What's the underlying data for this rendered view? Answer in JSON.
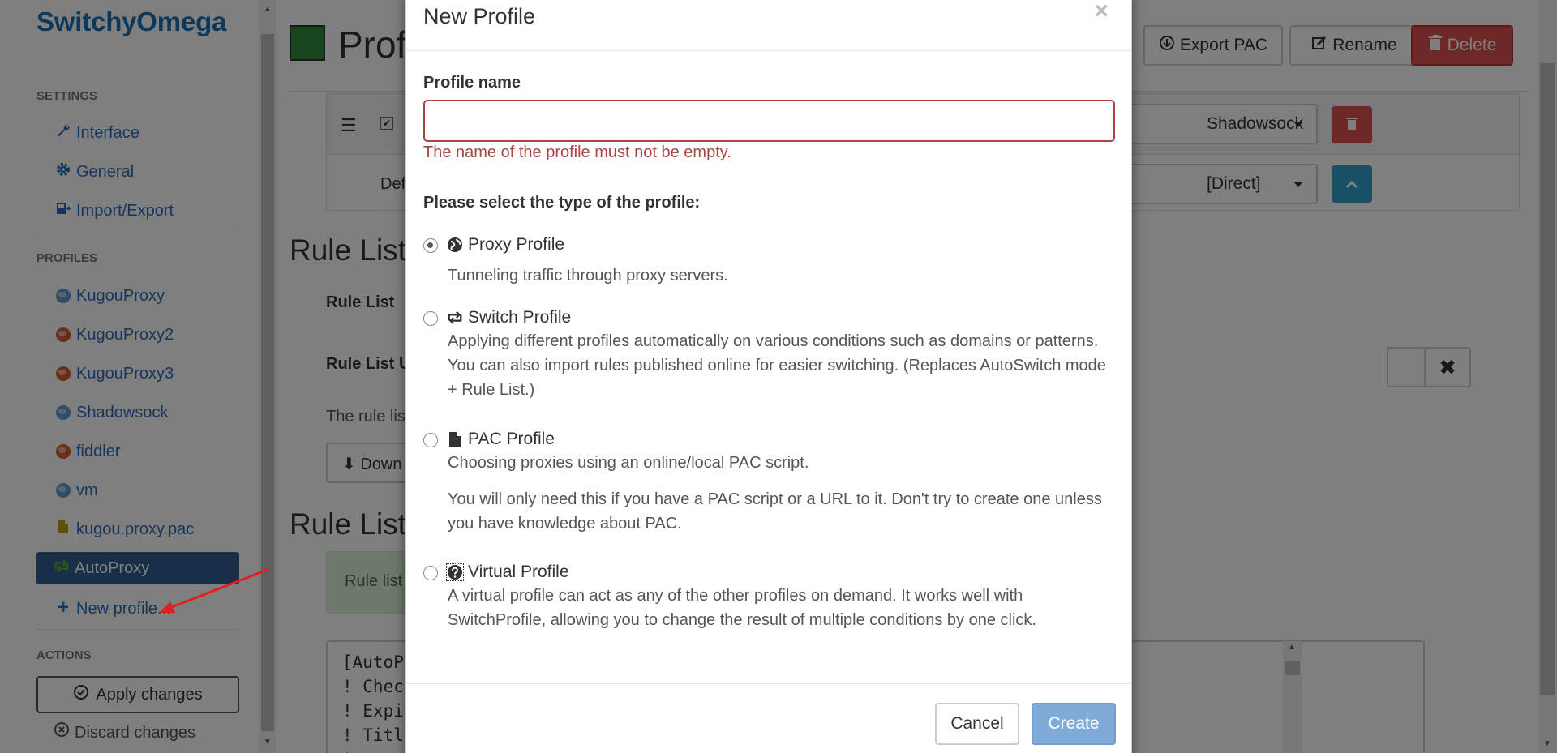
{
  "app": {
    "brand": "SwitchyOmega"
  },
  "sidebar": {
    "settings_header": "SETTINGS",
    "settings_items": [
      {
        "label": "Interface",
        "icon": "wrench-icon"
      },
      {
        "label": "General",
        "icon": "gear-icon"
      },
      {
        "label": "Import/Export",
        "icon": "import-export-icon"
      }
    ],
    "profiles_header": "PROFILES",
    "profiles": [
      {
        "label": "KugouProxy",
        "icon": "globe-icon",
        "color": "#5d9bd5"
      },
      {
        "label": "KugouProxy2",
        "icon": "globe-icon",
        "color": "#d9582b"
      },
      {
        "label": "KugouProxy3",
        "icon": "globe-icon",
        "color": "#d9582b"
      },
      {
        "label": "Shadowsock",
        "icon": "globe-icon",
        "color": "#5d9bd5"
      },
      {
        "label": "fiddler",
        "icon": "globe-icon",
        "color": "#d9582b"
      },
      {
        "label": "vm",
        "icon": "globe-icon",
        "color": "#5d9bd5"
      },
      {
        "label": "kugou.proxy.pac",
        "icon": "file-icon",
        "color": "#b8a015"
      },
      {
        "label": "AutoProxy",
        "icon": "switch-icon",
        "color": "#55b030",
        "active": true
      }
    ],
    "new_profile": "New profile...",
    "actions_header": "ACTIONS",
    "apply_changes": "Apply changes",
    "discard_changes": "Discard changes"
  },
  "main": {
    "page_title": "Profi",
    "export_pac": "Export PAC",
    "rename": "Rename",
    "delete": "Delete",
    "row1_select": "Shadowsock",
    "row2_label": "Def",
    "row2_select": "[Direct]",
    "rule_list_title_1": "Rule List",
    "rule_list_label_1": "Rule List",
    "rule_list_label_2": "Rule List U",
    "rule_list_muted": "The rule lis",
    "download_btn": "Down",
    "rule_list_title_2": "Rule List",
    "alert_text": "Rule list",
    "code_lines": [
      "[AutoP",
      "! Chec",
      "! Expi",
      "! Titl",
      "! ---"
    ]
  },
  "modal": {
    "title": "New Profile",
    "close": "×",
    "profile_name_label": "Profile name",
    "profile_name_value": "",
    "error_text": "The name of the profile must not be empty.",
    "type_label": "Please select the type of the profile:",
    "options": [
      {
        "title": "Proxy Profile",
        "icon": "globe-icon",
        "checked": true,
        "desc": "Tunneling traffic through proxy servers."
      },
      {
        "title": "Switch Profile",
        "icon": "switch-icon",
        "checked": false,
        "desc": "Applying different profiles automatically on various conditions such as domains or patterns. You can also import rules published online for easier switching. (Replaces AutoSwitch mode + Rule List.)"
      },
      {
        "title": "PAC Profile",
        "icon": "file-icon",
        "checked": false,
        "desc": "Choosing proxies using an online/local PAC script.",
        "desc2": "You will only need this if you have a PAC script or a URL to it. Don't try to create one unless you have knowledge about PAC."
      },
      {
        "title": "Virtual Profile",
        "icon": "question-circle-icon",
        "checked": false,
        "desc": "A virtual profile can act as any of the other profiles on demand. It works well with SwitchProfile, allowing you to change the result of multiple conditions by one click."
      }
    ],
    "cancel": "Cancel",
    "create": "Create"
  }
}
